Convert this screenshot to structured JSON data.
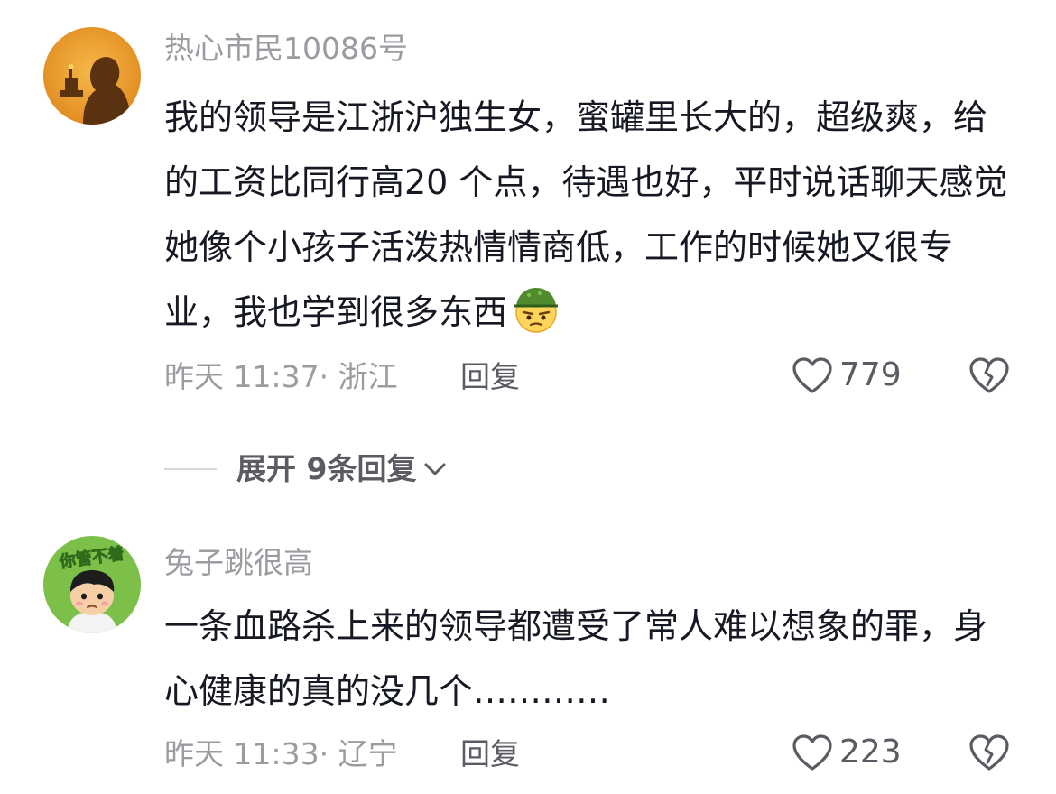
{
  "comments": [
    {
      "username": "热心市民10086号",
      "content": "我的领导是江浙沪独生女，蜜罐里长大的，超级爽，给的工资比同行高20 个点，待遇也好，平时说话聊天感觉她像个小孩子活泼热情情商低，工作的时候她又很专业，我也学到很多东西",
      "meta": "昨天 11:37· 浙江",
      "reply_label": "回复",
      "likes": "779",
      "emoji_icon": "thinking-face-green-hat-icon"
    },
    {
      "username": "兔子跳很高",
      "content": "一条血路杀上来的领导都遭受了常人难以想象的罪，身心健康的真的没几个…………",
      "meta": "昨天 11:33· 辽宁",
      "reply_label": "回复",
      "likes": "223",
      "avatar_text": "你管不着"
    }
  ],
  "expand_replies": {
    "label": "展开 9条回复"
  },
  "colors": {
    "text_primary": "#161823",
    "text_secondary": "#9b9ba1",
    "action": "#5b5b63",
    "avatar1_bg": "#f0a02e",
    "avatar2_bg": "#7cc04a"
  }
}
